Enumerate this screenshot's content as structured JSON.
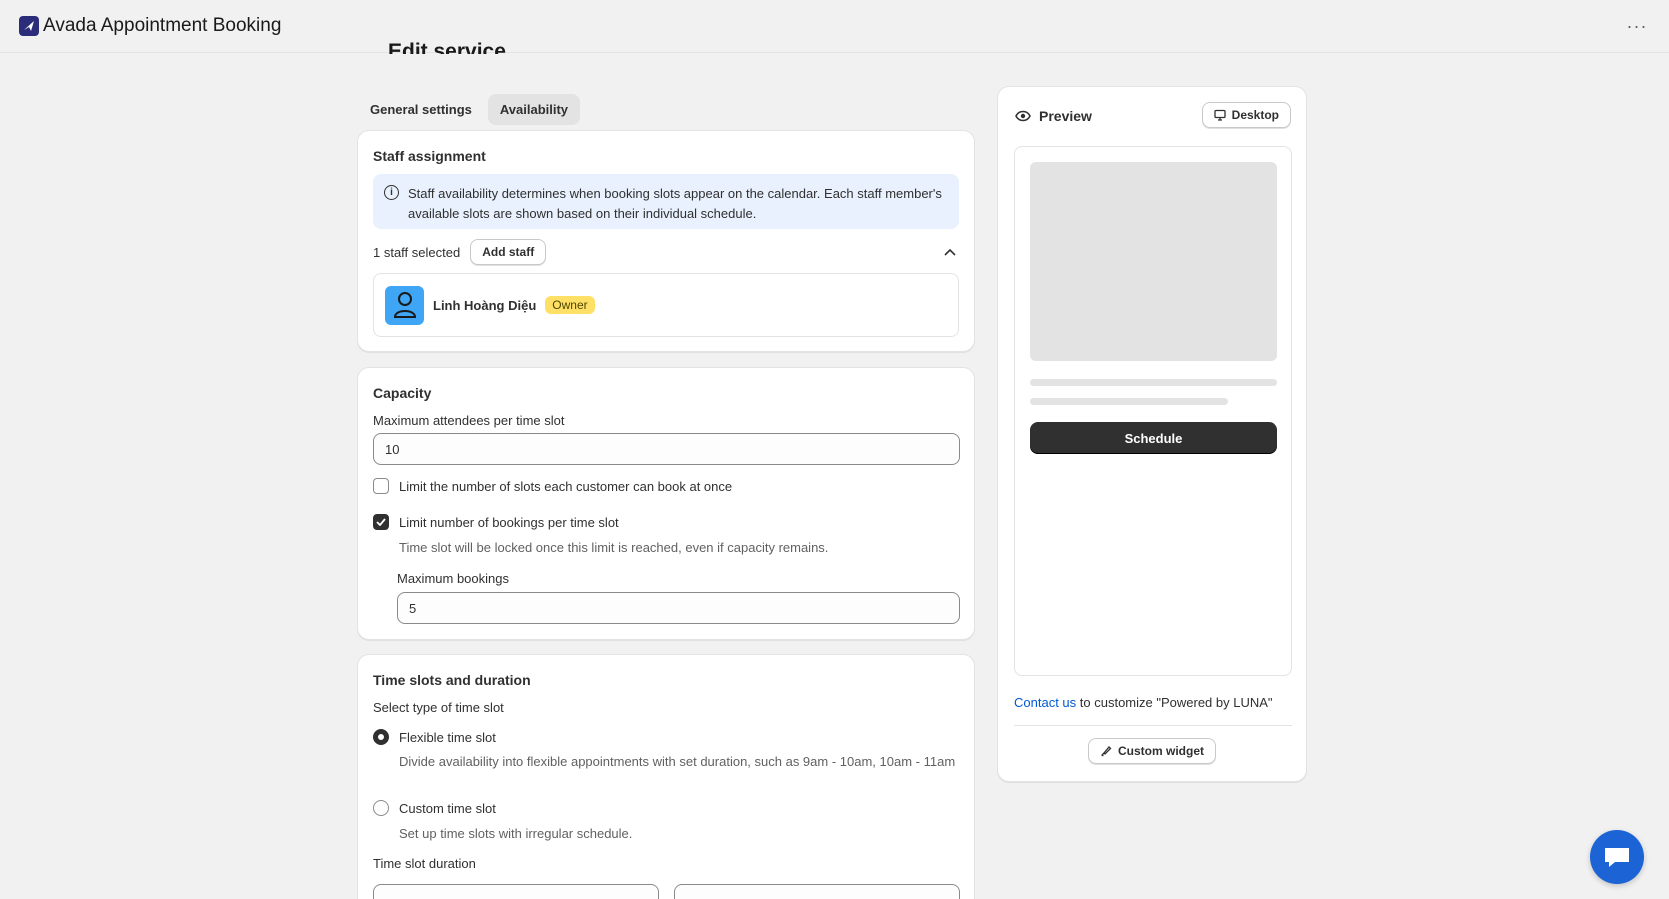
{
  "app": {
    "title": "Avada Appointment Booking",
    "more_label": "···"
  },
  "page": {
    "heading": "Edit service"
  },
  "tabs": [
    {
      "label": "General settings",
      "active": false
    },
    {
      "label": "Availability",
      "active": true
    }
  ],
  "staff": {
    "title": "Staff assignment",
    "banner_text": "Staff availability determines when booking slots appear on the calendar. Each staff member's available slots are shown based on their individual schedule.",
    "selected_text": "1 staff selected",
    "add_button": "Add staff",
    "member": {
      "name": "Linh Hoàng Diệu",
      "badge": "Owner"
    }
  },
  "capacity": {
    "title": "Capacity",
    "max_attendees_label": "Maximum attendees per time slot",
    "max_attendees_value": "10",
    "limit_slots_label": "Limit the number of slots each customer can book at once",
    "limit_slots_checked": false,
    "limit_bookings_label": "Limit number of bookings per time slot",
    "limit_bookings_checked": true,
    "limit_bookings_help": "Time slot will be locked once this limit is reached, even if capacity remains.",
    "max_bookings_label": "Maximum bookings",
    "max_bookings_value": "5"
  },
  "timeslots": {
    "title": "Time slots and duration",
    "type_label": "Select type of time slot",
    "flexible_label": "Flexible time slot",
    "flexible_help": "Divide availability into flexible appointments with set duration, such as 9am - 10am, 10am - 11am",
    "custom_label": "Custom time slot",
    "custom_help": "Set up time slots with irregular schedule.",
    "duration_label": "Time slot duration"
  },
  "preview": {
    "title": "Preview",
    "device_button": "Desktop",
    "schedule_button": "Schedule",
    "contact_link": "Contact us",
    "contact_text": " to customize \"Powered by LUNA\"",
    "custom_widget_button": "Custom widget"
  },
  "colors": {
    "accent": "#303030",
    "link": "#005bd3",
    "banner": "#e8f1fd",
    "badge": "#ffe066",
    "chat": "#1c63d6"
  }
}
